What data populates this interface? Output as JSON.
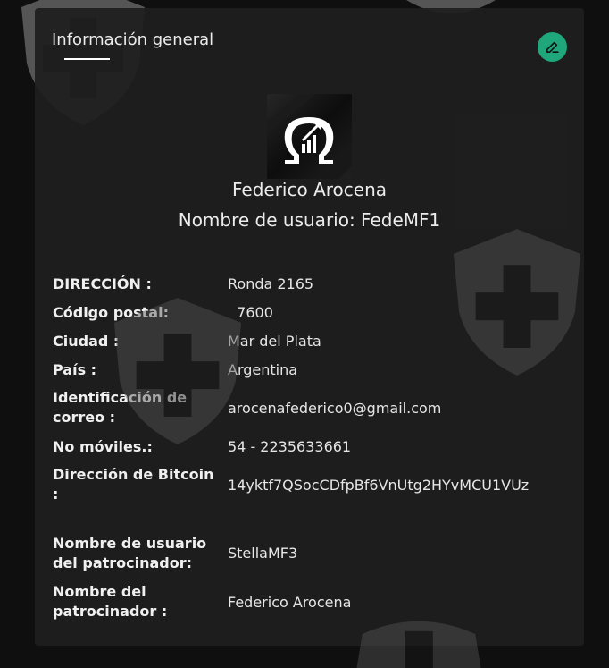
{
  "card": {
    "title": "Información general",
    "edit_button_label": "Editar"
  },
  "profile": {
    "avatar_icon": "omega-growth-logo-icon",
    "name": "Federico Arocena",
    "username_line": "Nombre de usuario: FedeMF1"
  },
  "details": [
    {
      "label": "DIRECCIÓN :",
      "value": "Ronda 2165"
    },
    {
      "label": "Código postal:",
      "value": "  7600"
    },
    {
      "label": "Ciudad :",
      "value": "Mar del Plata"
    },
    {
      "label": "País :",
      "value": "Argentina"
    },
    {
      "label": "Identificación de correo :",
      "value": "arocenafederico0@gmail.com"
    },
    {
      "label": "No móviles.:",
      "value": "54 - 2235633661"
    },
    {
      "label": "Dirección de Bitcoin :",
      "value": "14yktf7QSocCDfpBf6VnUtg2HYvMCU1VUz"
    },
    {
      "label": "Nombre de usuario del patrocinador:",
      "value": "StellaMF3"
    },
    {
      "label": "Nombre del patrocinador :",
      "value": "Federico Arocena"
    }
  ],
  "colors": {
    "accent": "#1fa67a",
    "card_background": "#1f1f1f",
    "page_background": "#0f0f0f",
    "watermark": "#555555"
  }
}
